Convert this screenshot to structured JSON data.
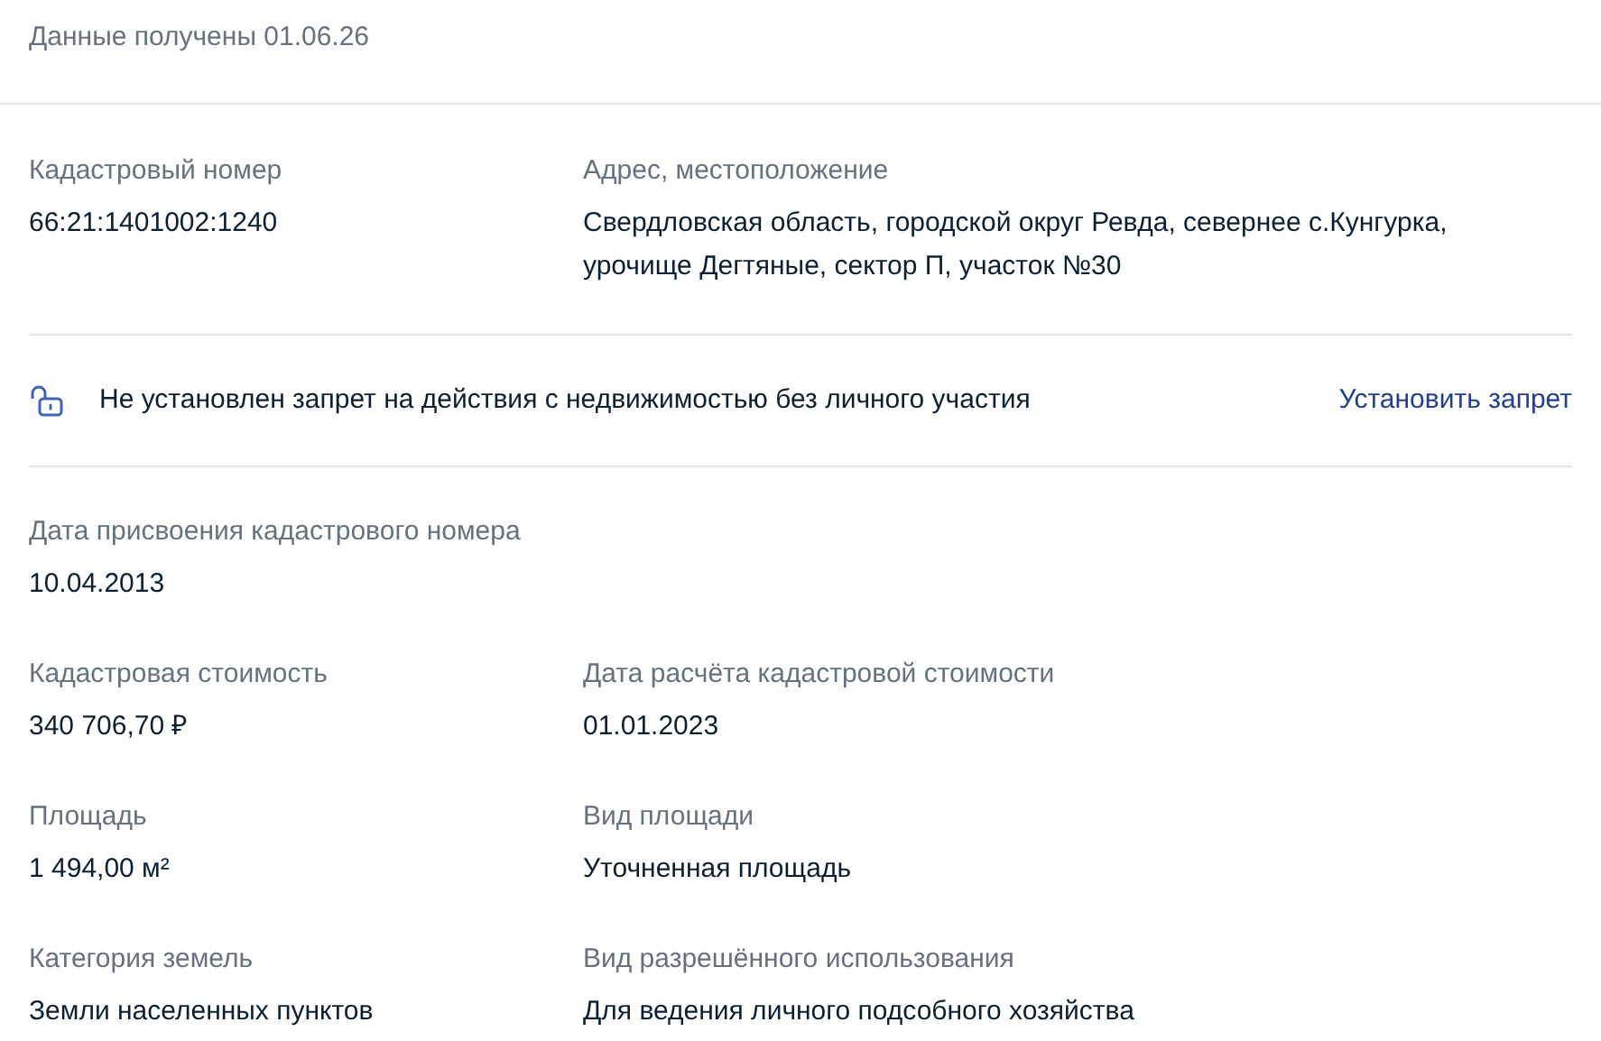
{
  "received": "Данные получены 01.06.26",
  "top_fields": [
    {
      "label": "Кадастровый номер",
      "value": "66:21:1401002:1240"
    },
    {
      "label": "Адрес, местоположение",
      "value": "Свердловская область, городской округ Ревда, севернее с.Кунгурка, урочище Дегтяные, сектор П, участок №30"
    }
  ],
  "restriction": {
    "text": "Не установлен запрет на действия с недвижимостью без личного участия",
    "action": "Установить запрет"
  },
  "rows": [
    [
      {
        "label": "Дата присвоения кадастрового номера",
        "value": "10.04.2013"
      }
    ],
    [
      {
        "label": "Кадастровая стоимость",
        "value": "340 706,70 ₽"
      },
      {
        "label": "Дата расчёта кадастровой стоимости",
        "value": "01.01.2023"
      }
    ],
    [
      {
        "label": "Площадь",
        "value": "1 494,00 м²"
      },
      {
        "label": "Вид площади",
        "value": "Уточненная площадь"
      }
    ],
    [
      {
        "label": "Категория земель",
        "value": "Земли населенных пунктов"
      },
      {
        "label": "Вид разрешённого использования",
        "value": "Для ведения личного подсобного хозяйства"
      }
    ]
  ]
}
